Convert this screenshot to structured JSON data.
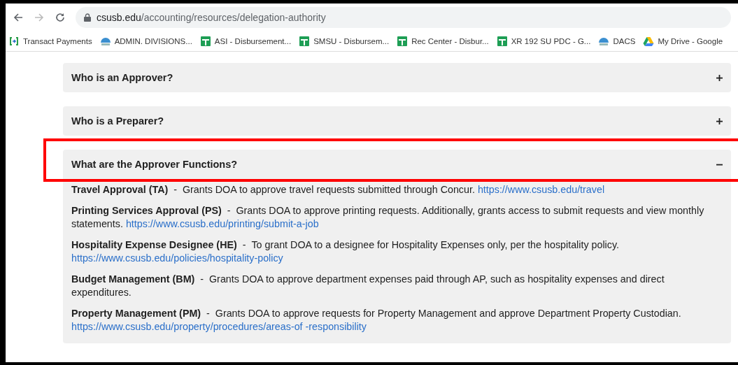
{
  "browser": {
    "url_domain": "csusb.edu",
    "url_path": "/accounting/resources/delegation-authority"
  },
  "bookmarks": [
    {
      "label": "Transact Payments",
      "kind": "transact"
    },
    {
      "label": "ADMIN. DIVISIONS...",
      "kind": "csusb"
    },
    {
      "label": "ASI - Disbursement...",
      "kind": "sheet"
    },
    {
      "label": "SMSU - Disbursem...",
      "kind": "sheet"
    },
    {
      "label": "Rec Center - Disbur...",
      "kind": "sheet"
    },
    {
      "label": "XR 192 SU PDC - G...",
      "kind": "sheet"
    },
    {
      "label": "DACS",
      "kind": "csusb"
    },
    {
      "label": "My Drive - Google",
      "kind": "drive"
    }
  ],
  "separator": "-",
  "accordion": [
    {
      "title": "Who is an Approver?",
      "expanded": false,
      "highlighted": false
    },
    {
      "title": "Who is a Preparer?",
      "expanded": false,
      "highlighted": false
    },
    {
      "title": "What are the Approver Functions?",
      "expanded": true,
      "highlighted": true,
      "functions": [
        {
          "term": "Travel Approval (TA)",
          "text": "Grants DOA to approve travel requests submitted through Concur.",
          "link": "https://www.csusb.edu/travel"
        },
        {
          "term": "Printing Services Approval (PS)",
          "text": "Grants DOA to approve printing requests. Additionally, grants access to submit requests and view monthly statements.",
          "link": "https://www.csusb.edu/printing/submit-a-job"
        },
        {
          "term": "Hospitality Expense Designee (HE)",
          "text": "To grant DOA to a designee for Hospitality Expenses only, per the hospitality policy.",
          "link": "https://www.csusb.edu/policies/hospitality-policy"
        },
        {
          "term": "Budget Management (BM)",
          "text": "Grants DOA to approve department expenses paid through AP, such as hospitality expenses and direct expenditures."
        },
        {
          "term": "Property Management (PM)",
          "text": "Grants DOA to approve requests for Property Management and approve Department Property Custodian.",
          "link": "https://www.csusb.edu/property/procedures/areas-of -responsibility"
        }
      ]
    }
  ]
}
